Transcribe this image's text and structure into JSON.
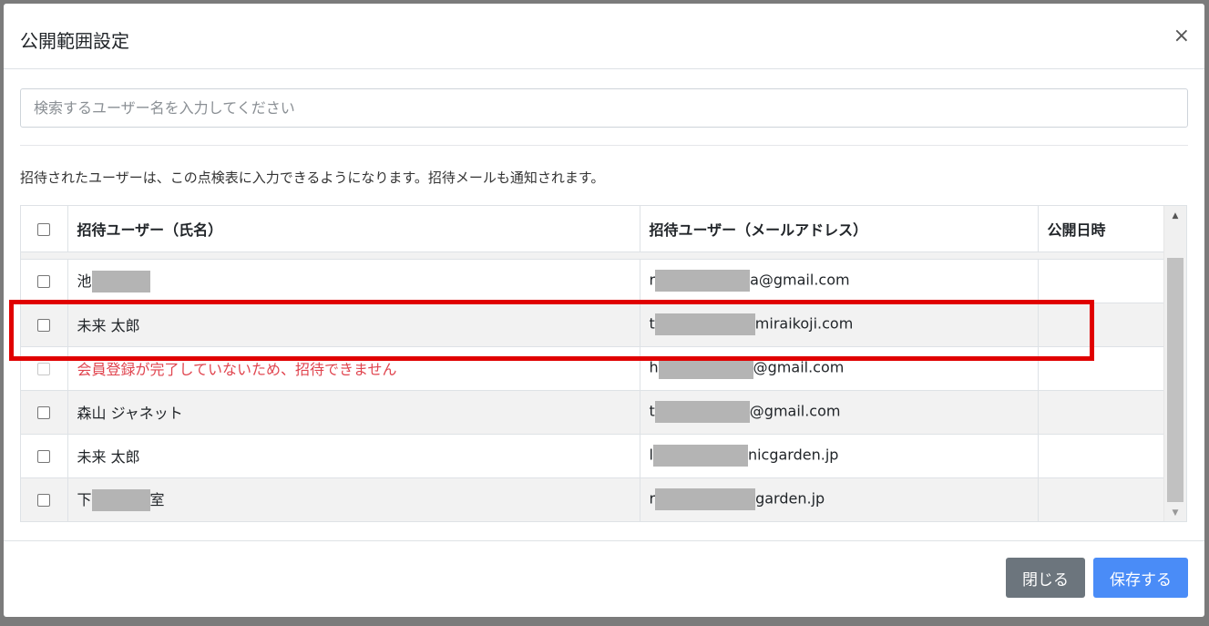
{
  "modal": {
    "title": "公開範囲設定",
    "close_symbol": "×"
  },
  "search": {
    "placeholder": "検索するユーザー名を入力してください",
    "value": ""
  },
  "info_text": "招待されたユーザーは、この点検表に入力できるようになります。招待メールも通知されます。",
  "table": {
    "headers": {
      "name": "招待ユーザー（氏名）",
      "email": "招待ユーザー（メールアドレス）",
      "date": "公開日時"
    },
    "rows": [
      {
        "name": "池",
        "email_prefix": "r",
        "email_suffix": "a@gmail.com",
        "date": "",
        "checked": false,
        "disabled": false
      },
      {
        "name": "未来 太郎",
        "email_prefix": "t",
        "email_suffix": "miraikoji.com",
        "date": "",
        "checked": false,
        "disabled": false
      },
      {
        "name": "会員登録が完了していないため、招待できません",
        "email_prefix": "h",
        "email_suffix": "@gmail.com",
        "date": "",
        "checked": false,
        "disabled": true
      },
      {
        "name": "森山 ジャネット",
        "email_prefix": "t",
        "email_suffix": "@gmail.com",
        "date": "",
        "checked": false,
        "disabled": false
      },
      {
        "name": "未来 太郎",
        "email_prefix": "l",
        "email_suffix": "nicgarden.jp",
        "date": "",
        "checked": false,
        "disabled": false
      },
      {
        "name_prefix": "下",
        "name_suffix": "室",
        "email_prefix": "r",
        "email_suffix": "garden.jp",
        "date": "",
        "checked": false,
        "disabled": false
      }
    ]
  },
  "buttons": {
    "close_label": "閉じる",
    "save_label": "保存する"
  },
  "colors": {
    "primary": "#4a8cf7",
    "secondary": "#6c757d",
    "error_text": "#e0454f",
    "highlight": "#e00000"
  }
}
